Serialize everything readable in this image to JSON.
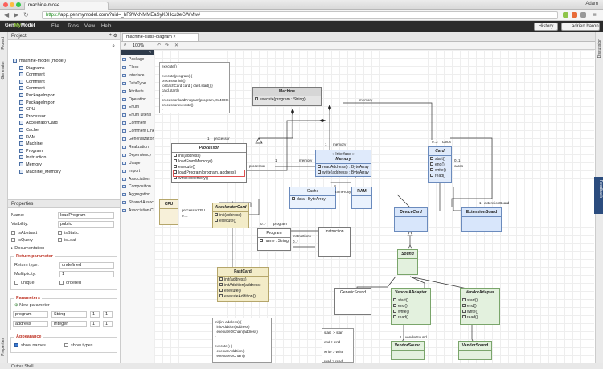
{
  "browser": {
    "tab_title": "machine-mose",
    "user": "Adam",
    "url_secure": "https://",
    "url_rest": "app.genmymodel.com/?uid=_hF9WkNMMEaSyK0Hcu3eGWMw#"
  },
  "app": {
    "logo_a": "Gen",
    "logo_b": "My",
    "logo_c": "Model",
    "menu": [
      "File",
      "Tools",
      "View",
      "Help"
    ],
    "history": "History",
    "user": "adrien baron"
  },
  "side_tabs": {
    "project": "Project",
    "generator": "Generator",
    "properties": "Properties",
    "discussion": "Discussion",
    "feedback": "Feedback"
  },
  "project": {
    "title": "Project",
    "search_placeholder": "",
    "tree": [
      "machine-model (model)",
      "Diagrams",
      "Comment",
      "Comment",
      "Comment",
      "PackageImport",
      "PackageImport",
      "CPU",
      "Processor",
      "AcceleratorCard",
      "Cache",
      "RAM",
      "Machine",
      "Program",
      "Instruction",
      "Memory",
      "Machine_Memory"
    ]
  },
  "properties": {
    "title": "Properties",
    "name_label": "Name:",
    "name_value": "loadProgram",
    "vis_label": "Visibility:",
    "vis_value": "public",
    "isAbstract": "isAbstract",
    "isStatic": "isStatic",
    "isQuery": "isQuery",
    "isLeaf": "isLeaf",
    "documentation": "Documentation",
    "return_head": "Return parameter",
    "ret_type_label": "Return type:",
    "ret_type": "undefined",
    "mult_label": "Multiplicity:",
    "mult_value": "1",
    "unique": "unique",
    "ordered": "ordered",
    "params_head": "Parameters",
    "new_param": "New parameter",
    "p1_name": "program",
    "p1_type": "String",
    "p1_m1": "1",
    "p1_m2": "1",
    "p2_name": "address",
    "p2_type": "Integer",
    "p2_m1": "1",
    "p2_m2": "1",
    "appearance_head": "Appearance",
    "show_names": "show names",
    "show_types": "show types"
  },
  "status": "Output Shell",
  "editor": {
    "tab": "machine-class-diagram",
    "zoom": "100%"
  },
  "palette": {
    "toggle": "«",
    "items": [
      "Package",
      "Class",
      "Interface",
      "DataType",
      "Attribute",
      "Operation",
      "Enum",
      "Enum Literal",
      "Comment",
      "Comment Link",
      "Generalization",
      "Realization",
      "Dependency",
      "Usage",
      "Import",
      "Association",
      "Composition",
      "Aggregation",
      "Shared Assoc",
      "Association Cl..."
    ]
  },
  "diagram": {
    "note1": "execute() {\n\nexecute(program) {\nprocessor.init()\nforEachCard card { card.start() }\ncard.start()\n}\nprocessor.loadProgram(program, 0x4000)\nprocessor.execute()\n}",
    "machine": {
      "name": "Machine",
      "ops": [
        "execute(program : String)"
      ]
    },
    "processor": {
      "name": "Processor",
      "ops": [
        "init(address)",
        "loadFromMemory()",
        "execute()",
        "loadProgram(program, address)",
        "writeToMemory()"
      ]
    },
    "memory": {
      "stereo": "« Interface »",
      "name": "Memory",
      "ops": [
        "readAddress() : ByteArray",
        "write(address) : ByteArray"
      ]
    },
    "card": {
      "name": "Card",
      "ops": [
        "start()",
        "end()",
        "write()",
        "read()"
      ]
    },
    "cpu": {
      "name": "CPU"
    },
    "accel": {
      "name": "AcceleratorCard",
      "ops": [
        "init(address)",
        "execute()"
      ]
    },
    "cache": {
      "name": "Cache",
      "attr": "data : ByteArray"
    },
    "ram": {
      "name": "RAM"
    },
    "program": {
      "name": "Program",
      "attr": "name : String"
    },
    "instruction": {
      "name": "Instruction"
    },
    "devicecard": {
      "name": "DeviceCard"
    },
    "extensionboard": {
      "name": "ExtensionBoard"
    },
    "sound": {
      "name": "Sound"
    },
    "fastcard": {
      "name": "FastCard",
      "ops": [
        "init(address)",
        "initAddition(address)",
        "execute()",
        "executeAddition()"
      ]
    },
    "genericsound": {
      "name": "GenericSound"
    },
    "vsa1": {
      "name": "VendorAAdapter",
      "ops": [
        "start()",
        "end()",
        "write()",
        "read()"
      ]
    },
    "vsa2": {
      "name": "VendorAdapter",
      "ops": [
        "start()",
        "end()",
        "write()",
        "read()"
      ]
    },
    "vendorsound1": {
      "name": "VendorSound"
    },
    "vendorsound2": {
      "name": "VendorSound"
    },
    "note2": "init(int address) {\n  initAddition(address)\n  executeIOChain(address)\n}\n\nexecute() {\n  executeAddition()\n  executeIOChain()",
    "note3": "start  > start\n\nend > end\n\nwrite > write\n\nread > read",
    "labels": {
      "processor": "processor",
      "memory": "memory",
      "memory2": "memory",
      "memory3": "memory",
      "cards": "cards",
      "m03": "0..3",
      "m01a": "0..1",
      "m01b": "0..*",
      "m1a": "1",
      "m1b": "1",
      "m1c": "1",
      "program": "program",
      "instructions": "instructions",
      "processorCPU": "processorCPU",
      "ramProxy": "ramProxy",
      "extBoard": "extensionBoard",
      "vendorSound": "vendorSound",
      "cards2": "cards",
      "processorlbl": "processor",
      "m1d": "1",
      "m1e": "1",
      "m01c": "0..1",
      "m01d": "0..*"
    }
  }
}
